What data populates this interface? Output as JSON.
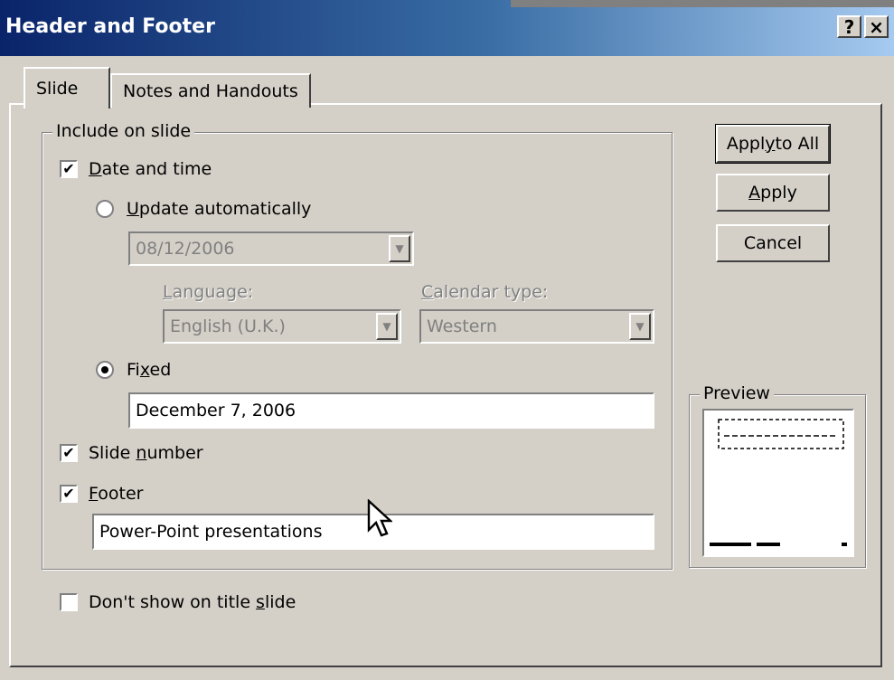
{
  "window": {
    "title": "Header and Footer",
    "help_label": "?",
    "close_label": "×"
  },
  "tabs": [
    {
      "label": "Slide",
      "active": true
    },
    {
      "label": "Notes and Handouts",
      "active": false
    }
  ],
  "include_group": {
    "legend": "Include on slide",
    "date_time": {
      "label_u": "D",
      "label_rest": "ate and time",
      "checked": true
    },
    "update_auto": {
      "label_u": "U",
      "label_rest": "pdate automatically",
      "selected": false
    },
    "auto_date_value": "08/12/2006",
    "language": {
      "label_u": "L",
      "label_rest": "anguage:",
      "value": "English (U.K.)"
    },
    "calendar": {
      "label_u": "C",
      "label_rest": "alendar type:",
      "value": "Western"
    },
    "fixed": {
      "label_pre": "Fi",
      "label_u": "x",
      "label_rest": "ed",
      "selected": true
    },
    "fixed_value": "December 7, 2006",
    "slide_number": {
      "label_pre": "Slide ",
      "label_u": "n",
      "label_rest": "umber",
      "checked": true
    },
    "footer": {
      "label_u": "F",
      "label_rest": "ooter",
      "checked": true
    },
    "footer_value": "Power-Point presentations"
  },
  "dont_show": {
    "label_pre": "Don't show on title ",
    "label_u": "s",
    "label_rest": "lide",
    "checked": false
  },
  "buttons": {
    "apply_all": {
      "pre": "Appl",
      "u": "y",
      "rest": " to All"
    },
    "apply": {
      "u": "A",
      "rest": "pply"
    },
    "cancel": "Cancel"
  },
  "preview": {
    "legend": "Preview"
  },
  "check_mark": "✔",
  "dropdown_arrow": "▼"
}
